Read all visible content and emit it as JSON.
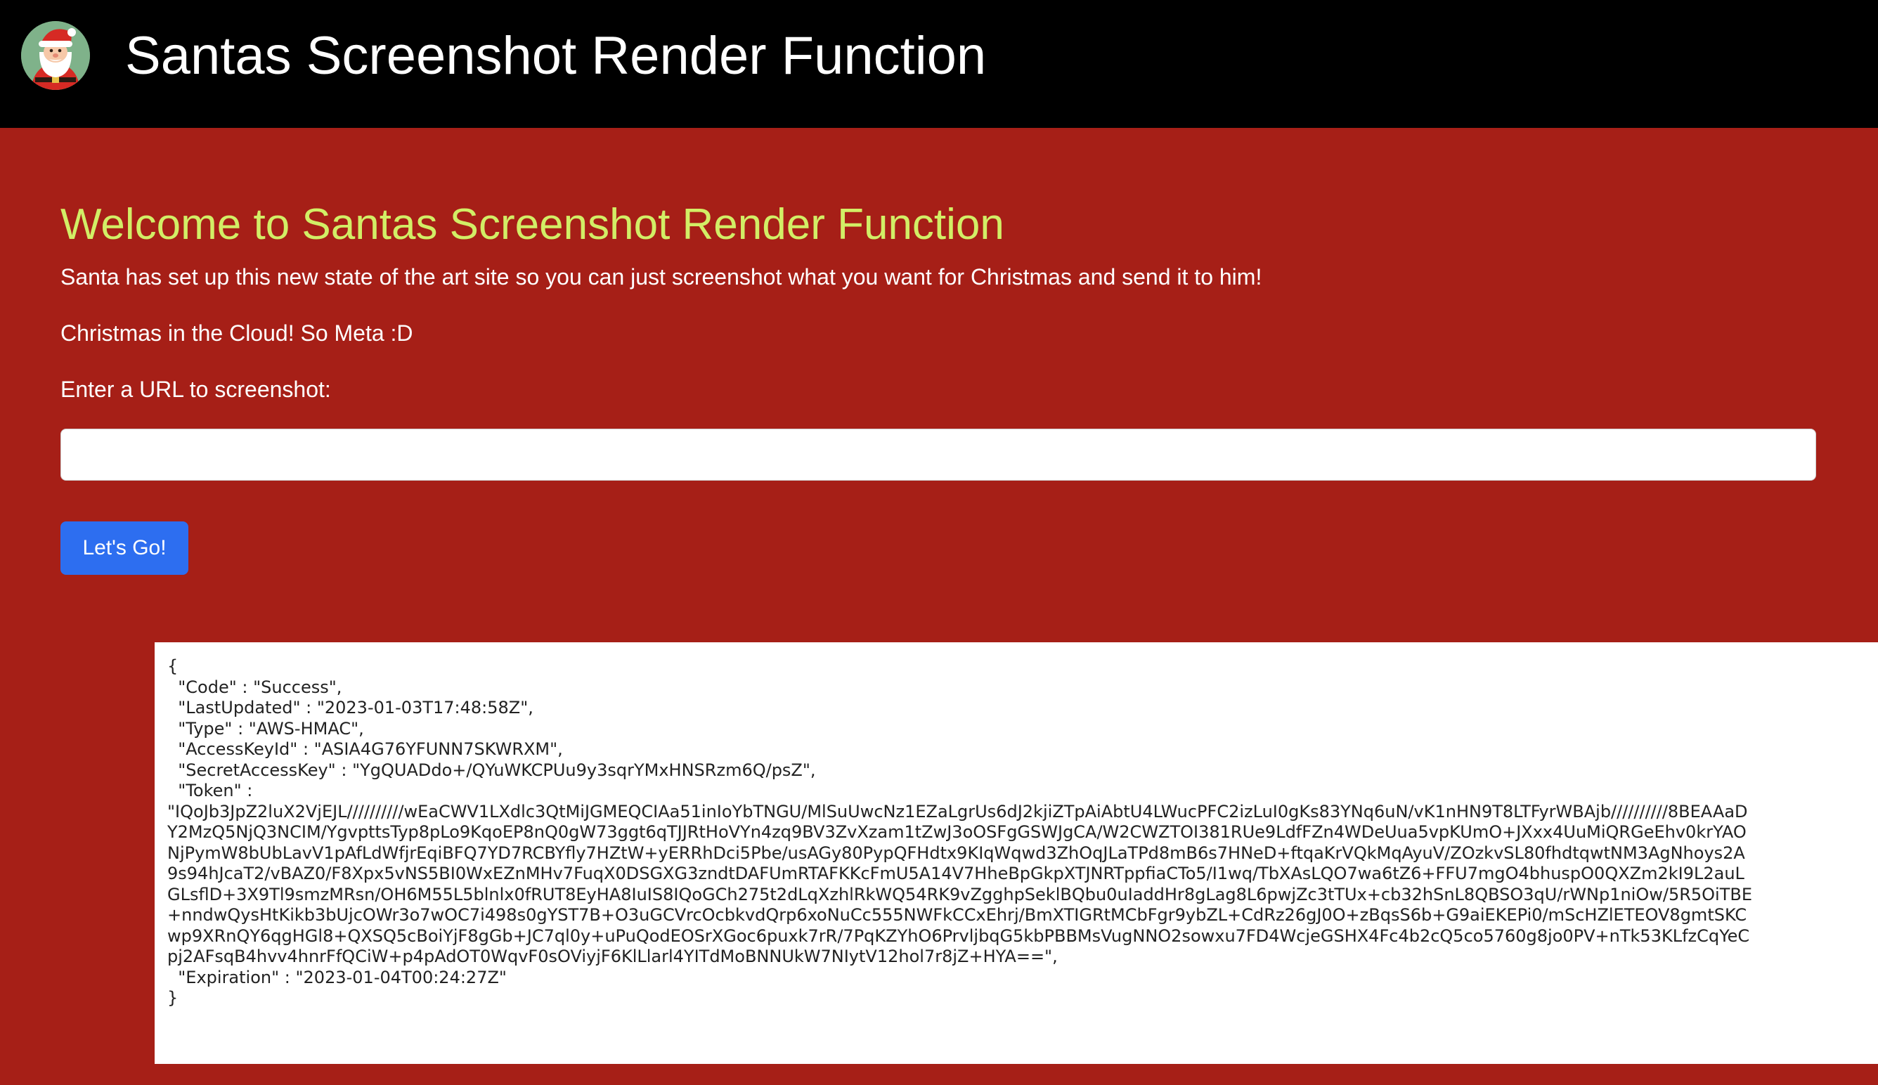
{
  "header": {
    "logo_icon": "santa-claus-icon",
    "title": "Santas Screenshot Render Function"
  },
  "main": {
    "heading": "Welcome to Santas Screenshot Render Function",
    "intro": "Santa has set up this new state of the art site so you can just screenshot what you want for Christmas and send it to him!",
    "tagline": "Christmas in the Cloud! So Meta :D",
    "url_label": "Enter a URL to screenshot:",
    "url_value": "",
    "url_placeholder": "",
    "go_button_label": "Let's Go!"
  },
  "result": {
    "text": "{\n  \"Code\" : \"Success\",\n  \"LastUpdated\" : \"2023-01-03T17:48:58Z\",\n  \"Type\" : \"AWS-HMAC\",\n  \"AccessKeyId\" : \"ASIA4G76YFUNN7SKWRXM\",\n  \"SecretAccessKey\" : \"YgQUADdo+/QYuWKCPUu9y3sqrYMxHNSRzm6Q/psZ\",\n  \"Token\" :\n\"IQoJb3JpZ2luX2VjEJL//////////wEaCWV1LXdlc3QtMiJGMEQCIAa51inIoYbTNGU/MlSuUwcNz1EZaLgrUs6dJ2kjiZTpAiAbtU4LWucPFC2izLuI0gKs83YNq6uN/vK1nHN9T8LTFyrWBAjb//////////8BEAAaD\nY2MzQ5NjQ3NCIM/YgvpttsTyp8pLo9KqoEP8nQ0gW73ggt6qTJJRtHoVYn4zq9BV3ZvXzam1tZwJ3oOSFgGSWJgCA/W2CWZTOI381RUe9LdfFZn4WDeUua5vpKUmO+JXxx4UuMiQRGeEhv0krYAO\nNjPymW8bUbLavV1pAfLdWfjrEqiBFQ7YD7RCBYfly7HZtW+yERRhDci5Pbe/usAGy80PypQFHdtx9KIqWqwd3ZhOqJLaTPd8mB6s7HNeD+ftqaKrVQkMqAyuV/ZOzkvSL80fhdtqwtNM3AgNhoys2A\n9s94hJcaT2/vBAZ0/F8Xpx5vNS5BI0WxEZnMHv7FuqX0DSGXG3zndtDAFUmRTAFKKcFmU5A14V7HheBpGkpXTJNRTppfiaCTo5/I1wq/TbXAsLQO7wa6tZ6+FFU7mgO4bhuspO0QXZm2kI9L2auL\nGLsflD+3X9Tl9smzMRsn/OH6M55L5blnlx0fRUT8EyHA8IuIS8IQoGCh275t2dLqXzhlRkWQ54RK9vZgghpSeklBQbu0uIaddHr8gLag8L6pwjZc3tTUx+cb32hSnL8QBSO3qU/rWNp1niOw/5R5OiTBE\n+nndwQysHtKikb3bUjcOWr3o7wOC7i498s0gYST7B+O3uGCVrcOcbkvdQrp6xoNuCc555NWFkCCxEhrj/BmXTIGRtMCbFgr9ybZL+CdRz26gJ0O+zBqsS6b+G9aiEKEPi0/mScHZlETEOV8gmtSKC\nwp9XRnQY6qgHGl8+QXSQ5cBoiYjF8gGb+JC7ql0y+uPuQodEOSrXGoc6puxk7rR/7PqKZYhO6PrvljbqG5kbPBBMsVugNNO2sowxu7FD4WcjeGSHX4Fc4b2cQ5co5760g8jo0PV+nTk53KLfzCqYeC\npj2AFsqB4hvv4hnrFfQCiW+p4pAdOT0WqvF0sOViyjF6KlLlarl4YITdMoBNNUkW7NIytV12hol7r8jZ+HYA==\",\n  \"Expiration\" : \"2023-01-04T00:24:27Z\"\n}"
  },
  "colors": {
    "header_bg": "#000000",
    "page_bg": "#a61f17",
    "heading": "#d2ee66",
    "button": "#2d6ef0"
  }
}
